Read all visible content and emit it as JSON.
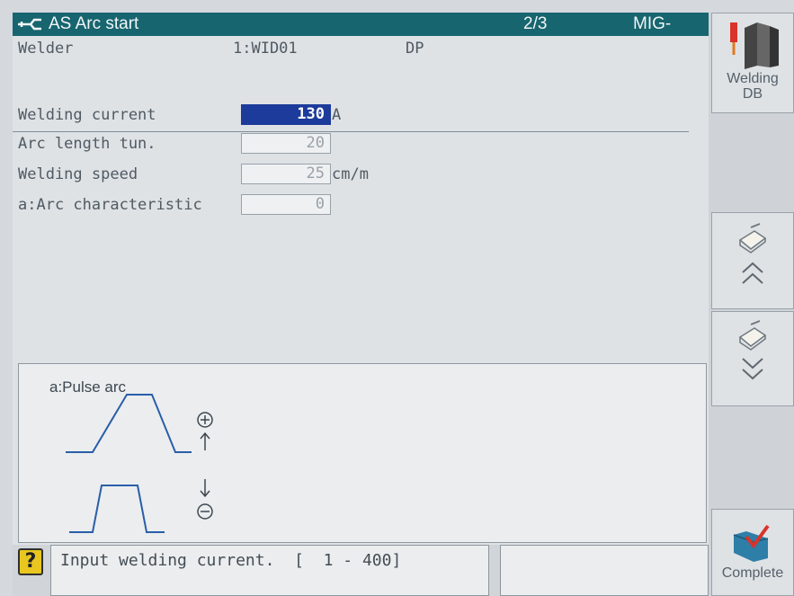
{
  "header": {
    "title": "AS Arc start",
    "page": "2/3",
    "mode": "MIG-MAG"
  },
  "welder": {
    "label": "Welder",
    "value": "1:WID01",
    "type": "DP"
  },
  "params": [
    {
      "label": "Welding current",
      "value": "130",
      "unit": "A"
    },
    {
      "label": "Arc length tun.",
      "value": "20",
      "unit": ""
    },
    {
      "label": "Welding speed",
      "value": "25",
      "unit": "cm/m"
    },
    {
      "label": "a:Arc characteristic",
      "value": "0",
      "unit": ""
    }
  ],
  "diagram": {
    "label": "a:Pulse arc"
  },
  "status": {
    "help_symbol": "?",
    "message": "Input welding current.  [  1 - 400]"
  },
  "sidebar": {
    "welding_db_label": "Welding DB",
    "complete_label": "Complete"
  }
}
